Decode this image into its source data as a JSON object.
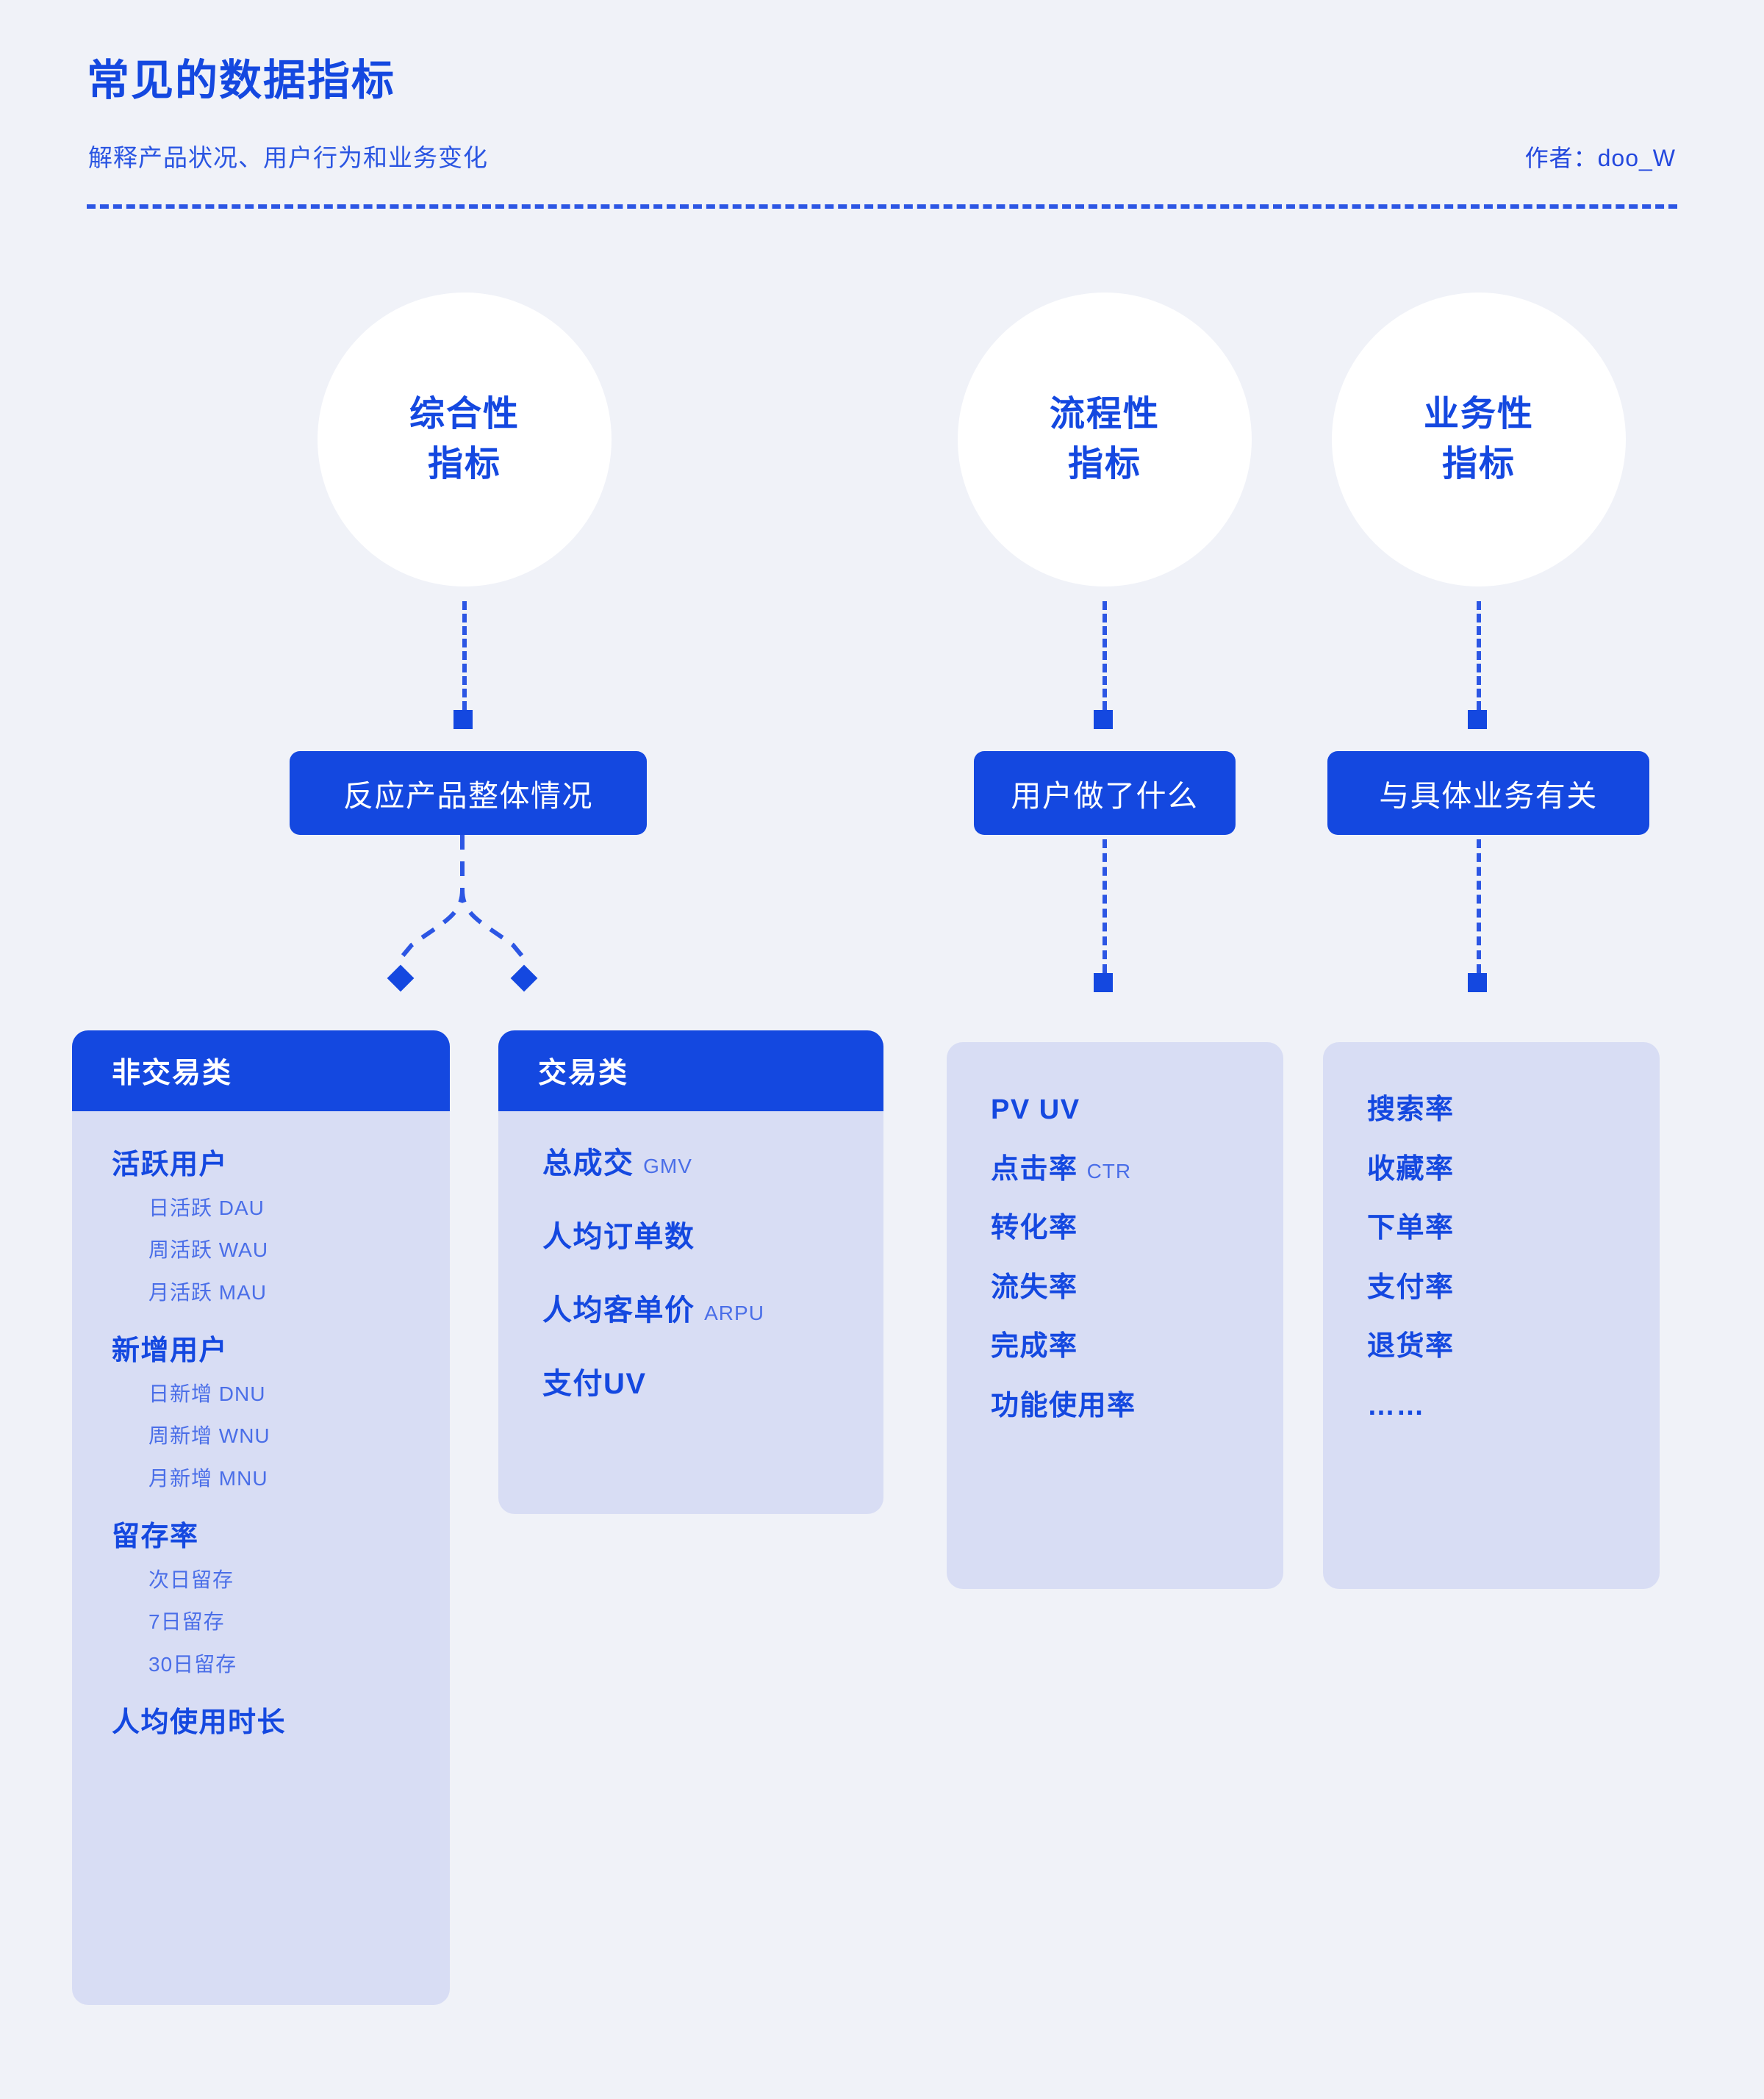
{
  "header": {
    "title": "常见的数据指标",
    "subtitle": "解释产品状况、用户行为和业务变化",
    "author": "作者：doo_W"
  },
  "colors": {
    "accent": "#1448E0",
    "card_body": "#D8DDF4",
    "page_bg": "#F0F2F8",
    "circle_bg": "#FFFFFF",
    "sub_text": "#4A6EE8"
  },
  "branches": [
    {
      "circle_label": "综合性\n指标",
      "circle_line1": "综合性",
      "circle_line2": "指标",
      "pill_label": "反应产品整体情况"
    },
    {
      "circle_label": "流程性\n指标",
      "circle_line1": "流程性",
      "circle_line2": "指标",
      "pill_label": "用户做了什么"
    },
    {
      "circle_label": "业务性\n指标",
      "circle_line1": "业务性",
      "circle_line2": "指标",
      "pill_label": "与具体业务有关"
    }
  ],
  "cards": {
    "non_transaction": {
      "header": "非交易类",
      "groups": [
        {
          "title": "活跃用户",
          "items": [
            "日活跃 DAU",
            "周活跃 WAU",
            "月活跃 MAU"
          ]
        },
        {
          "title": "新增用户",
          "items": [
            "日新增 DNU",
            "周新增 WNU",
            "月新增 MNU"
          ]
        },
        {
          "title": "留存率",
          "items": [
            "次日留存",
            "7日留存",
            "30日留存"
          ]
        },
        {
          "title": "人均使用时长",
          "items": []
        }
      ]
    },
    "transaction": {
      "header": "交易类",
      "items": [
        {
          "label": "总成交",
          "abbr": "GMV"
        },
        {
          "label": "人均订单数",
          "abbr": ""
        },
        {
          "label": "人均客单价",
          "abbr": "ARPU"
        },
        {
          "label": "支付UV",
          "abbr": ""
        }
      ]
    },
    "process": {
      "header": "",
      "items": [
        {
          "label": "PV UV",
          "abbr": ""
        },
        {
          "label": "点击率",
          "abbr": "CTR"
        },
        {
          "label": "转化率",
          "abbr": ""
        },
        {
          "label": "流失率",
          "abbr": ""
        },
        {
          "label": "完成率",
          "abbr": ""
        },
        {
          "label": "功能使用率",
          "abbr": ""
        }
      ]
    },
    "business": {
      "header": "",
      "items": [
        {
          "label": "搜索率",
          "abbr": ""
        },
        {
          "label": "收藏率",
          "abbr": ""
        },
        {
          "label": "下单率",
          "abbr": ""
        },
        {
          "label": "支付率",
          "abbr": ""
        },
        {
          "label": "退货率",
          "abbr": ""
        },
        {
          "label": "……",
          "abbr": ""
        }
      ]
    }
  }
}
